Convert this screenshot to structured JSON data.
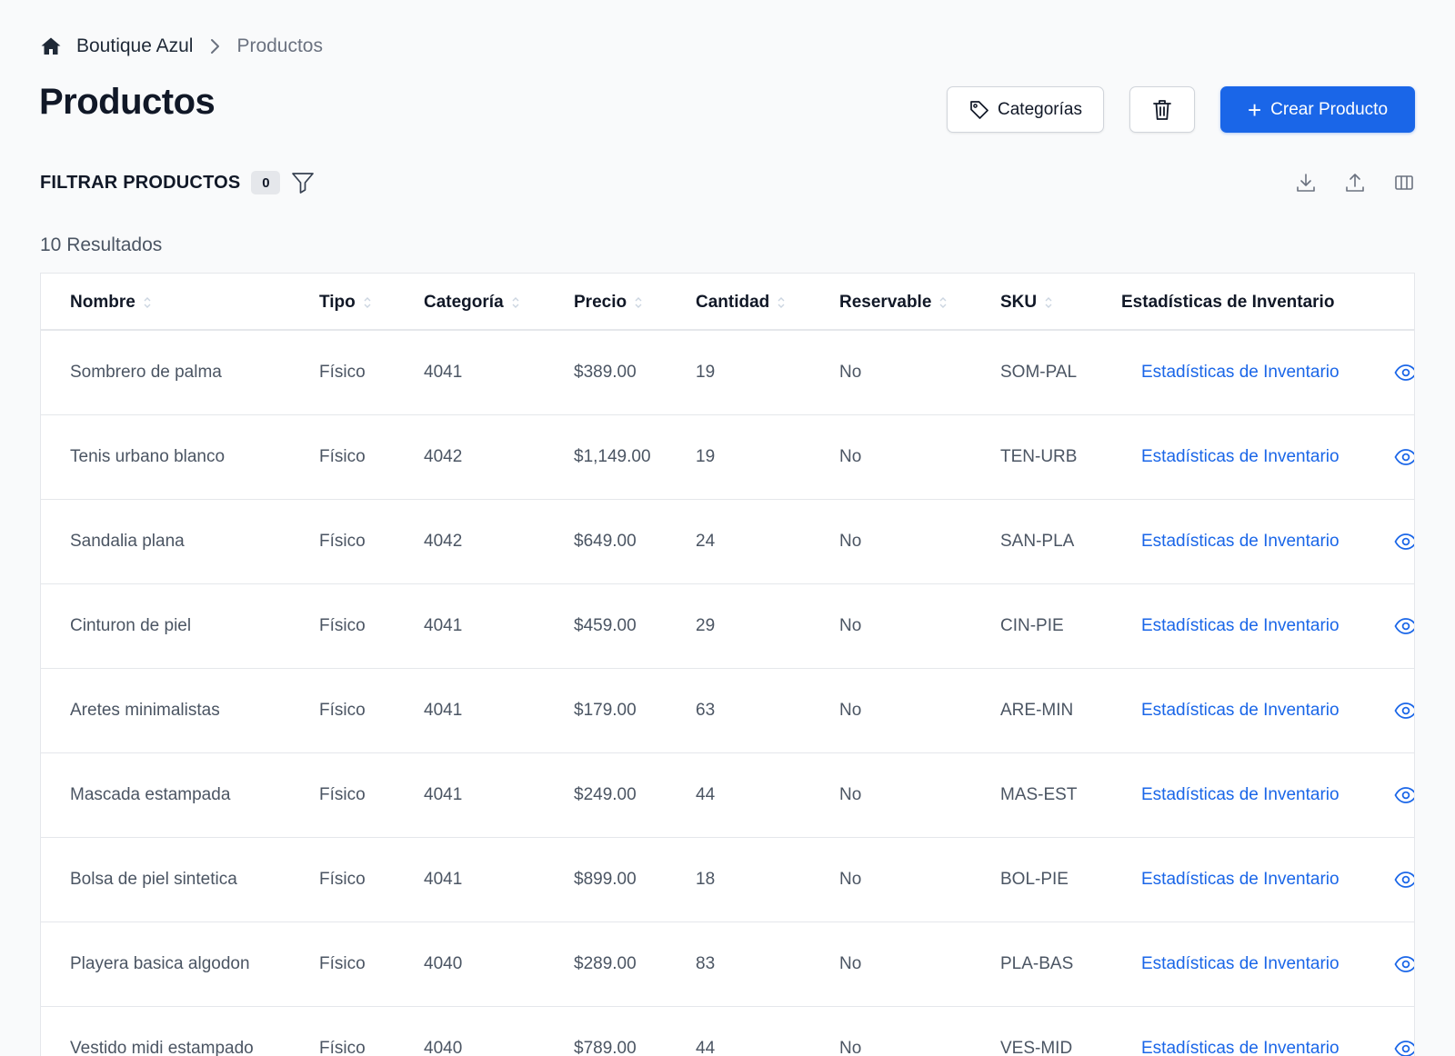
{
  "breadcrumb": {
    "store": "Boutique Azul",
    "current": "Productos"
  },
  "page": {
    "title": "Productos"
  },
  "actions": {
    "categories_label": "Categorías",
    "create_label": "Crear Producto",
    "create_color": "#1a66e8"
  },
  "filter": {
    "label": "FILTRAR PRODUCTOS",
    "count": "0"
  },
  "results": "10 Resultados",
  "table": {
    "headers": [
      "Nombre",
      "Tipo",
      "Categoría",
      "Precio",
      "Cantidad",
      "Reservable",
      "SKU",
      "Estadísticas de Inventario"
    ],
    "rows": [
      {
        "nombre": "Sombrero de palma",
        "tipo": "Físico",
        "categoria": "4041",
        "precio": "$389.00",
        "cantidad": "19",
        "reservable": "No",
        "sku": "SOM-PAL",
        "stats": "Estadísticas de Inventario"
      },
      {
        "nombre": "Tenis urbano blanco",
        "tipo": "Físico",
        "categoria": "4042",
        "precio": "$1,149.00",
        "cantidad": "19",
        "reservable": "No",
        "sku": "TEN-URB",
        "stats": "Estadísticas de Inventario"
      },
      {
        "nombre": "Sandalia plana",
        "tipo": "Físico",
        "categoria": "4042",
        "precio": "$649.00",
        "cantidad": "24",
        "reservable": "No",
        "sku": "SAN-PLA",
        "stats": "Estadísticas de Inventario"
      },
      {
        "nombre": "Cinturon de piel",
        "tipo": "Físico",
        "categoria": "4041",
        "precio": "$459.00",
        "cantidad": "29",
        "reservable": "No",
        "sku": "CIN-PIE",
        "stats": "Estadísticas de Inventario"
      },
      {
        "nombre": "Aretes minimalistas",
        "tipo": "Físico",
        "categoria": "4041",
        "precio": "$179.00",
        "cantidad": "63",
        "reservable": "No",
        "sku": "ARE-MIN",
        "stats": "Estadísticas de Inventario"
      },
      {
        "nombre": "Mascada estampada",
        "tipo": "Físico",
        "categoria": "4041",
        "precio": "$249.00",
        "cantidad": "44",
        "reservable": "No",
        "sku": "MAS-EST",
        "stats": "Estadísticas de Inventario"
      },
      {
        "nombre": "Bolsa de piel sintetica",
        "tipo": "Físico",
        "categoria": "4041",
        "precio": "$899.00",
        "cantidad": "18",
        "reservable": "No",
        "sku": "BOL-PIE",
        "stats": "Estadísticas de Inventario"
      },
      {
        "nombre": "Playera basica algodon",
        "tipo": "Físico",
        "categoria": "4040",
        "precio": "$289.00",
        "cantidad": "83",
        "reservable": "No",
        "sku": "PLA-BAS",
        "stats": "Estadísticas de Inventario"
      },
      {
        "nombre": "Vestido midi estampado",
        "tipo": "Físico",
        "categoria": "4040",
        "precio": "$789.00",
        "cantidad": "44",
        "reservable": "No",
        "sku": "VES-MID",
        "stats": "Estadísticas de Inventario"
      }
    ]
  }
}
